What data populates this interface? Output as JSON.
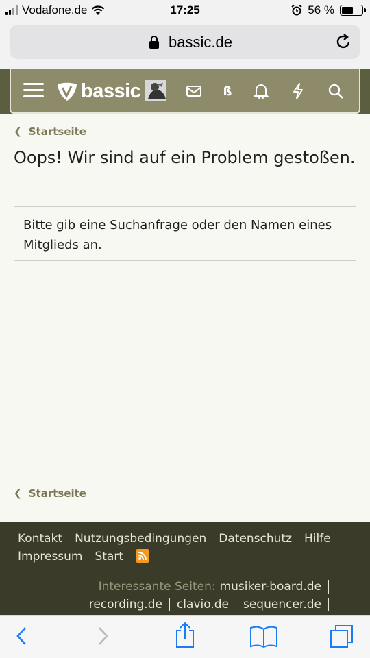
{
  "status_bar": {
    "carrier": "Vodafone.de",
    "time": "17:25",
    "battery": "56 %",
    "battery_level": 0.56
  },
  "browser": {
    "url": "bassic.de"
  },
  "header": {
    "logo_text": "bassic"
  },
  "page": {
    "breadcrumb": "Startseite",
    "title": "Oops! Wir sind auf ein Problem gestoßen.",
    "message": "Bitte gib eine Suchanfrage oder den Namen eines Mitglieds an.",
    "breadcrumb_bottom": "Startseite"
  },
  "footer": {
    "links": [
      "Kontakt",
      "Nutzungsbedingungen",
      "Datenschutz",
      "Hilfe",
      "Impressum",
      "Start"
    ],
    "interesting_label": "Interessante Seiten:",
    "sites": [
      "musiker-board.de",
      "recording.de",
      "clavio.de",
      "sequencer.de"
    ]
  },
  "colors": {
    "header": "#8d8b6a",
    "header_outer": "#5b5f40",
    "footer": "#3b3b29",
    "accent": "#7a7857",
    "ios_blue": "#1a7cf6"
  }
}
